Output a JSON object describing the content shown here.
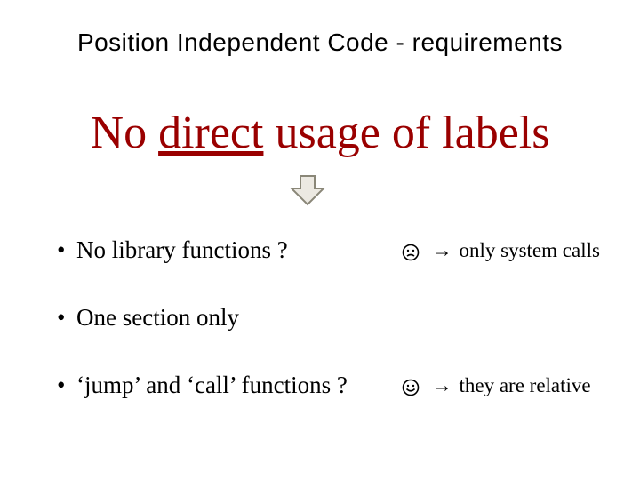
{
  "title": "Position Independent Code - requirements",
  "headline": {
    "pre": "No ",
    "underlined": "direct",
    "post": " usage of labels"
  },
  "bullets": {
    "b1": "No library functions ?",
    "b2": "One section only",
    "b3": "‘jump’ and ‘call’ functions ?"
  },
  "resolutions": {
    "r1": {
      "arrow": "→",
      "text": " only system calls"
    },
    "r3": {
      "arrow": "→",
      "text": " they are relative"
    }
  },
  "icons": {
    "sad": "sad-face-icon",
    "happy": "happy-face-icon",
    "down": "down-arrow-icon"
  }
}
